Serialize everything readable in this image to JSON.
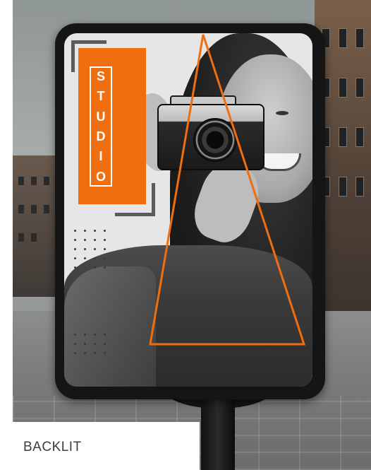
{
  "poster": {
    "brand_letters": [
      "S",
      "T",
      "U",
      "D",
      "I",
      "O"
    ],
    "accent_color": "#ef6f10"
  },
  "caption": {
    "label": "BACKLIT"
  }
}
